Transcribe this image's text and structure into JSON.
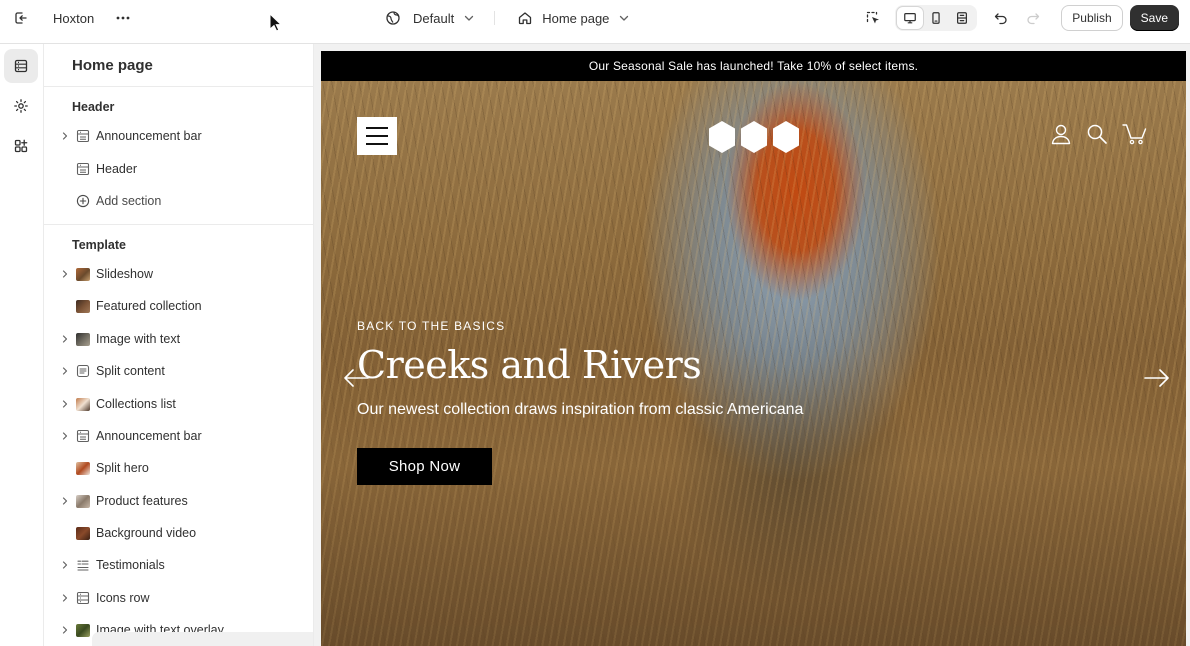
{
  "topbar": {
    "store_name": "Hoxton",
    "theme": "Default",
    "page": "Home page",
    "publish_label": "Publish",
    "save_label": "Save"
  },
  "sidebar": {
    "title": "Home page",
    "header_group": {
      "label": "Header",
      "items": [
        {
          "label": "Announcement bar",
          "expandable": true,
          "icon": "layout-section-icon"
        },
        {
          "label": "Header",
          "expandable": false,
          "icon": "layout-section-icon"
        }
      ],
      "add_label": "Add section"
    },
    "template_group": {
      "label": "Template",
      "items": [
        {
          "label": "Slideshow",
          "expandable": true,
          "icon": "image-thumbnail"
        },
        {
          "label": "Featured collection",
          "expandable": false,
          "icon": "image-thumbnail"
        },
        {
          "label": "Image with text",
          "expandable": true,
          "icon": "image-thumbnail"
        },
        {
          "label": "Split content",
          "expandable": true,
          "icon": "text-block-icon"
        },
        {
          "label": "Collections list",
          "expandable": true,
          "icon": "image-thumbnail"
        },
        {
          "label": "Announcement bar",
          "expandable": true,
          "icon": "layout-section-icon"
        },
        {
          "label": "Split hero",
          "expandable": false,
          "icon": "image-thumbnail"
        },
        {
          "label": "Product features",
          "expandable": true,
          "icon": "image-thumbnail"
        },
        {
          "label": "Background video",
          "expandable": false,
          "icon": "image-thumbnail"
        },
        {
          "label": "Testimonials",
          "expandable": true,
          "icon": "list-icon"
        },
        {
          "label": "Icons row",
          "expandable": true,
          "icon": "layout-section-icon"
        },
        {
          "label": "Image with text overlay",
          "expandable": true,
          "icon": "image-thumbnail"
        }
      ]
    }
  },
  "preview": {
    "announcement": "Our Seasonal Sale has launched! Take 10% of select items.",
    "eyebrow": "BACK TO THE BASICS",
    "headline": "Creeks and Rivers",
    "subhead": "Our newest collection draws inspiration from classic Americana",
    "cta": "Shop Now"
  },
  "colors": {
    "accent": "#303030",
    "announcement_bg": "#000000",
    "cta_bg": "#000000"
  }
}
